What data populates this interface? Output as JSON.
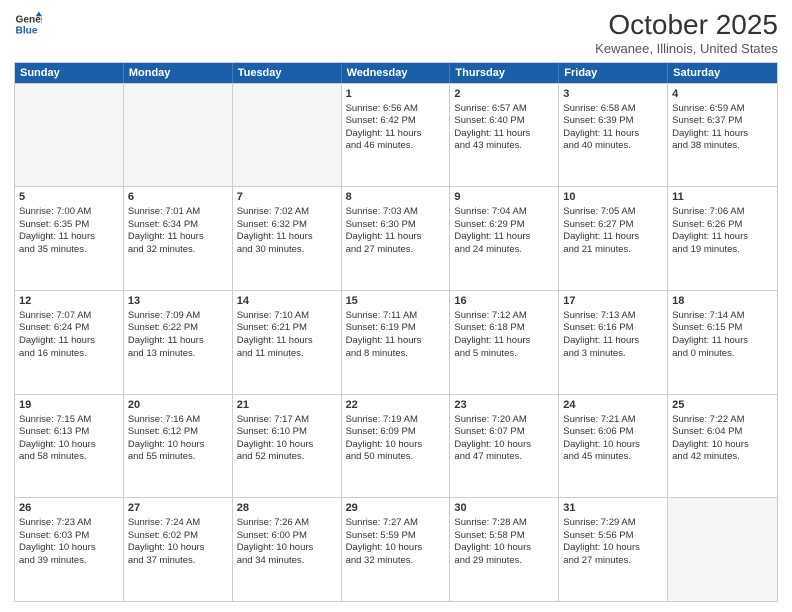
{
  "header": {
    "logo_line1": "General",
    "logo_line2": "Blue",
    "title": "October 2025",
    "subtitle": "Kewanee, Illinois, United States"
  },
  "days_of_week": [
    "Sunday",
    "Monday",
    "Tuesday",
    "Wednesday",
    "Thursday",
    "Friday",
    "Saturday"
  ],
  "weeks": [
    [
      {
        "day": "",
        "info": ""
      },
      {
        "day": "",
        "info": ""
      },
      {
        "day": "",
        "info": ""
      },
      {
        "day": "1",
        "info": "Sunrise: 6:56 AM\nSunset: 6:42 PM\nDaylight: 11 hours\nand 46 minutes."
      },
      {
        "day": "2",
        "info": "Sunrise: 6:57 AM\nSunset: 6:40 PM\nDaylight: 11 hours\nand 43 minutes."
      },
      {
        "day": "3",
        "info": "Sunrise: 6:58 AM\nSunset: 6:39 PM\nDaylight: 11 hours\nand 40 minutes."
      },
      {
        "day": "4",
        "info": "Sunrise: 6:59 AM\nSunset: 6:37 PM\nDaylight: 11 hours\nand 38 minutes."
      }
    ],
    [
      {
        "day": "5",
        "info": "Sunrise: 7:00 AM\nSunset: 6:35 PM\nDaylight: 11 hours\nand 35 minutes."
      },
      {
        "day": "6",
        "info": "Sunrise: 7:01 AM\nSunset: 6:34 PM\nDaylight: 11 hours\nand 32 minutes."
      },
      {
        "day": "7",
        "info": "Sunrise: 7:02 AM\nSunset: 6:32 PM\nDaylight: 11 hours\nand 30 minutes."
      },
      {
        "day": "8",
        "info": "Sunrise: 7:03 AM\nSunset: 6:30 PM\nDaylight: 11 hours\nand 27 minutes."
      },
      {
        "day": "9",
        "info": "Sunrise: 7:04 AM\nSunset: 6:29 PM\nDaylight: 11 hours\nand 24 minutes."
      },
      {
        "day": "10",
        "info": "Sunrise: 7:05 AM\nSunset: 6:27 PM\nDaylight: 11 hours\nand 21 minutes."
      },
      {
        "day": "11",
        "info": "Sunrise: 7:06 AM\nSunset: 6:26 PM\nDaylight: 11 hours\nand 19 minutes."
      }
    ],
    [
      {
        "day": "12",
        "info": "Sunrise: 7:07 AM\nSunset: 6:24 PM\nDaylight: 11 hours\nand 16 minutes."
      },
      {
        "day": "13",
        "info": "Sunrise: 7:09 AM\nSunset: 6:22 PM\nDaylight: 11 hours\nand 13 minutes."
      },
      {
        "day": "14",
        "info": "Sunrise: 7:10 AM\nSunset: 6:21 PM\nDaylight: 11 hours\nand 11 minutes."
      },
      {
        "day": "15",
        "info": "Sunrise: 7:11 AM\nSunset: 6:19 PM\nDaylight: 11 hours\nand 8 minutes."
      },
      {
        "day": "16",
        "info": "Sunrise: 7:12 AM\nSunset: 6:18 PM\nDaylight: 11 hours\nand 5 minutes."
      },
      {
        "day": "17",
        "info": "Sunrise: 7:13 AM\nSunset: 6:16 PM\nDaylight: 11 hours\nand 3 minutes."
      },
      {
        "day": "18",
        "info": "Sunrise: 7:14 AM\nSunset: 6:15 PM\nDaylight: 11 hours\nand 0 minutes."
      }
    ],
    [
      {
        "day": "19",
        "info": "Sunrise: 7:15 AM\nSunset: 6:13 PM\nDaylight: 10 hours\nand 58 minutes."
      },
      {
        "day": "20",
        "info": "Sunrise: 7:16 AM\nSunset: 6:12 PM\nDaylight: 10 hours\nand 55 minutes."
      },
      {
        "day": "21",
        "info": "Sunrise: 7:17 AM\nSunset: 6:10 PM\nDaylight: 10 hours\nand 52 minutes."
      },
      {
        "day": "22",
        "info": "Sunrise: 7:19 AM\nSunset: 6:09 PM\nDaylight: 10 hours\nand 50 minutes."
      },
      {
        "day": "23",
        "info": "Sunrise: 7:20 AM\nSunset: 6:07 PM\nDaylight: 10 hours\nand 47 minutes."
      },
      {
        "day": "24",
        "info": "Sunrise: 7:21 AM\nSunset: 6:06 PM\nDaylight: 10 hours\nand 45 minutes."
      },
      {
        "day": "25",
        "info": "Sunrise: 7:22 AM\nSunset: 6:04 PM\nDaylight: 10 hours\nand 42 minutes."
      }
    ],
    [
      {
        "day": "26",
        "info": "Sunrise: 7:23 AM\nSunset: 6:03 PM\nDaylight: 10 hours\nand 39 minutes."
      },
      {
        "day": "27",
        "info": "Sunrise: 7:24 AM\nSunset: 6:02 PM\nDaylight: 10 hours\nand 37 minutes."
      },
      {
        "day": "28",
        "info": "Sunrise: 7:26 AM\nSunset: 6:00 PM\nDaylight: 10 hours\nand 34 minutes."
      },
      {
        "day": "29",
        "info": "Sunrise: 7:27 AM\nSunset: 5:59 PM\nDaylight: 10 hours\nand 32 minutes."
      },
      {
        "day": "30",
        "info": "Sunrise: 7:28 AM\nSunset: 5:58 PM\nDaylight: 10 hours\nand 29 minutes."
      },
      {
        "day": "31",
        "info": "Sunrise: 7:29 AM\nSunset: 5:56 PM\nDaylight: 10 hours\nand 27 minutes."
      },
      {
        "day": "",
        "info": ""
      }
    ]
  ]
}
